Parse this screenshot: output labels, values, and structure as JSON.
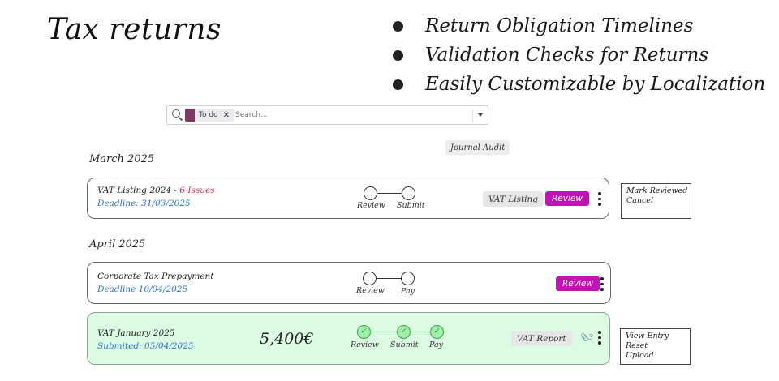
{
  "header": {
    "title": "Tax returns",
    "features": [
      "Return Obligation Timelines",
      "Validation Checks for Returns",
      "Easily Customizable by Localization"
    ]
  },
  "search": {
    "facet_label": "To do",
    "placeholder": "Search..."
  },
  "journal_audit_label": "Journal Audit",
  "groups": [
    {
      "month": "March 2025",
      "cards": [
        {
          "name": "VAT Listing 2024 -",
          "issues": "6 Issues",
          "deadline": "Deadline: 31/03/2025",
          "steps": [
            "Review",
            "Submit"
          ],
          "tag": "VAT Listing",
          "button": "Review",
          "menu": [
            "Mark Reviewed",
            "Cancel"
          ]
        }
      ]
    },
    {
      "month": "April 2025",
      "cards": [
        {
          "name": "Corporate Tax Prepayment",
          "deadline": "Deadline 10/04/2025",
          "steps": [
            "Review",
            "Pay"
          ],
          "button": "Review"
        },
        {
          "name": "VAT January 2025",
          "deadline": "Submited: 05/04/2025",
          "amount": "5,400€",
          "steps": [
            "Review",
            "Submit",
            "Pay"
          ],
          "tag": "VAT Report",
          "attachment_count": "3",
          "menu": [
            "View Entry",
            "Reset",
            "Upload"
          ]
        }
      ]
    }
  ],
  "colors": {
    "primary_button": "#c411b7",
    "issues": "#e22a56",
    "deadline": "#2a74c7",
    "completed_card": "#dcfbe3",
    "completed_step": "#9ff0a9"
  }
}
